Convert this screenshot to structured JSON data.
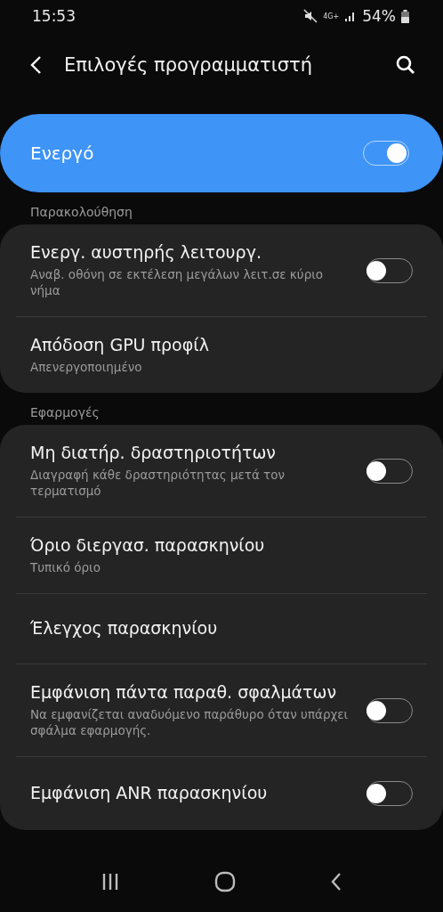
{
  "status_bar": {
    "time": "15:53",
    "network": "4G+",
    "battery": "54%"
  },
  "header": {
    "title": "Επιλογές προγραμματιστή"
  },
  "master": {
    "label": "Ενεργό",
    "on": true
  },
  "sections": [
    {
      "title": "Παρακολούθηση",
      "items": [
        {
          "kind": "toggle",
          "title": "Ενεργ. αυστηρής λειτουργ.",
          "subtitle": "Αναβ. οθόνη σε εκτέλεση μεγάλων λειτ.σε κύριο νήμα",
          "on": false
        },
        {
          "kind": "value",
          "title": "Απόδοση GPU προφίλ",
          "subtitle": "Απενεργοποιημένο"
        }
      ]
    },
    {
      "title": "Εφαρμογές",
      "items": [
        {
          "kind": "toggle",
          "title": "Μη διατήρ. δραστηριοτήτων",
          "subtitle": "Διαγραφή κάθε δραστηριότητας μετά τον τερματισμό",
          "on": false
        },
        {
          "kind": "value",
          "title": "Όριο διεργασ. παρασκηνίου",
          "subtitle": "Τυπικό όριο"
        },
        {
          "kind": "link",
          "title": "Έλεγχος παρασκηνίου"
        },
        {
          "kind": "toggle",
          "title": "Εμφάνιση πάντα παραθ. σφαλμάτων",
          "subtitle": "Να εμφανίζεται αναδυόμενο παράθυρο όταν υπάρχει σφάλμα εφαρμογής.",
          "on": false
        },
        {
          "kind": "toggle",
          "title": "Εμφάνιση ANR παρασκηνίου",
          "on": false
        }
      ]
    }
  ]
}
